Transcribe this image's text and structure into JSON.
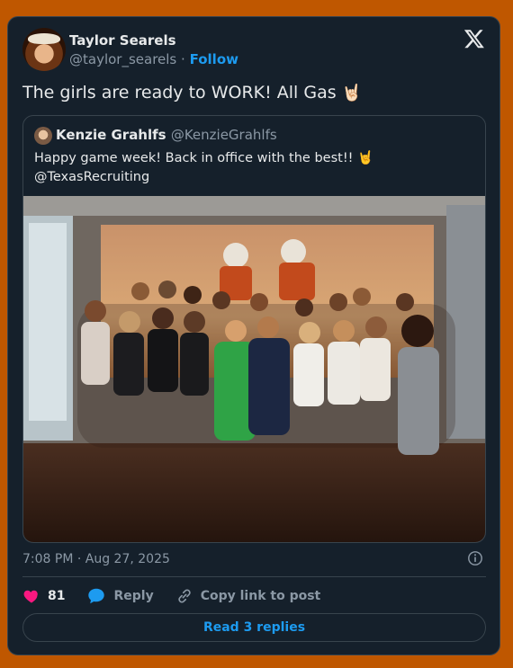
{
  "colors": {
    "page_bg": "#bf5700",
    "card_bg": "#15202b",
    "accent": "#1d9bf0",
    "like": "#f91880"
  },
  "author": {
    "name": "Taylor Searels",
    "handle": "@taylor_searels",
    "separator": "·",
    "follow_label": "Follow"
  },
  "tweet": {
    "text": "The girls are ready to WORK! All Gas",
    "emoji": "🤘🏻"
  },
  "quoted": {
    "name": "Kenzie Grahlfs",
    "handle": "@KenzieGrahlfs",
    "text_line1": "Happy game week! Back in office with the best!! 🤘",
    "text_line2": "@TexasRecruiting",
    "photo_alt": "Group photo in front of a football mural"
  },
  "footer": {
    "timestamp": "7:08 PM · Aug 27, 2025",
    "like_count": "81",
    "reply_label": "Reply",
    "copy_label": "Copy link to post",
    "read_replies_label": "Read 3 replies"
  },
  "icons": [
    "x-logo-icon",
    "info-icon",
    "heart-icon",
    "reply-bubble-icon",
    "link-icon"
  ]
}
